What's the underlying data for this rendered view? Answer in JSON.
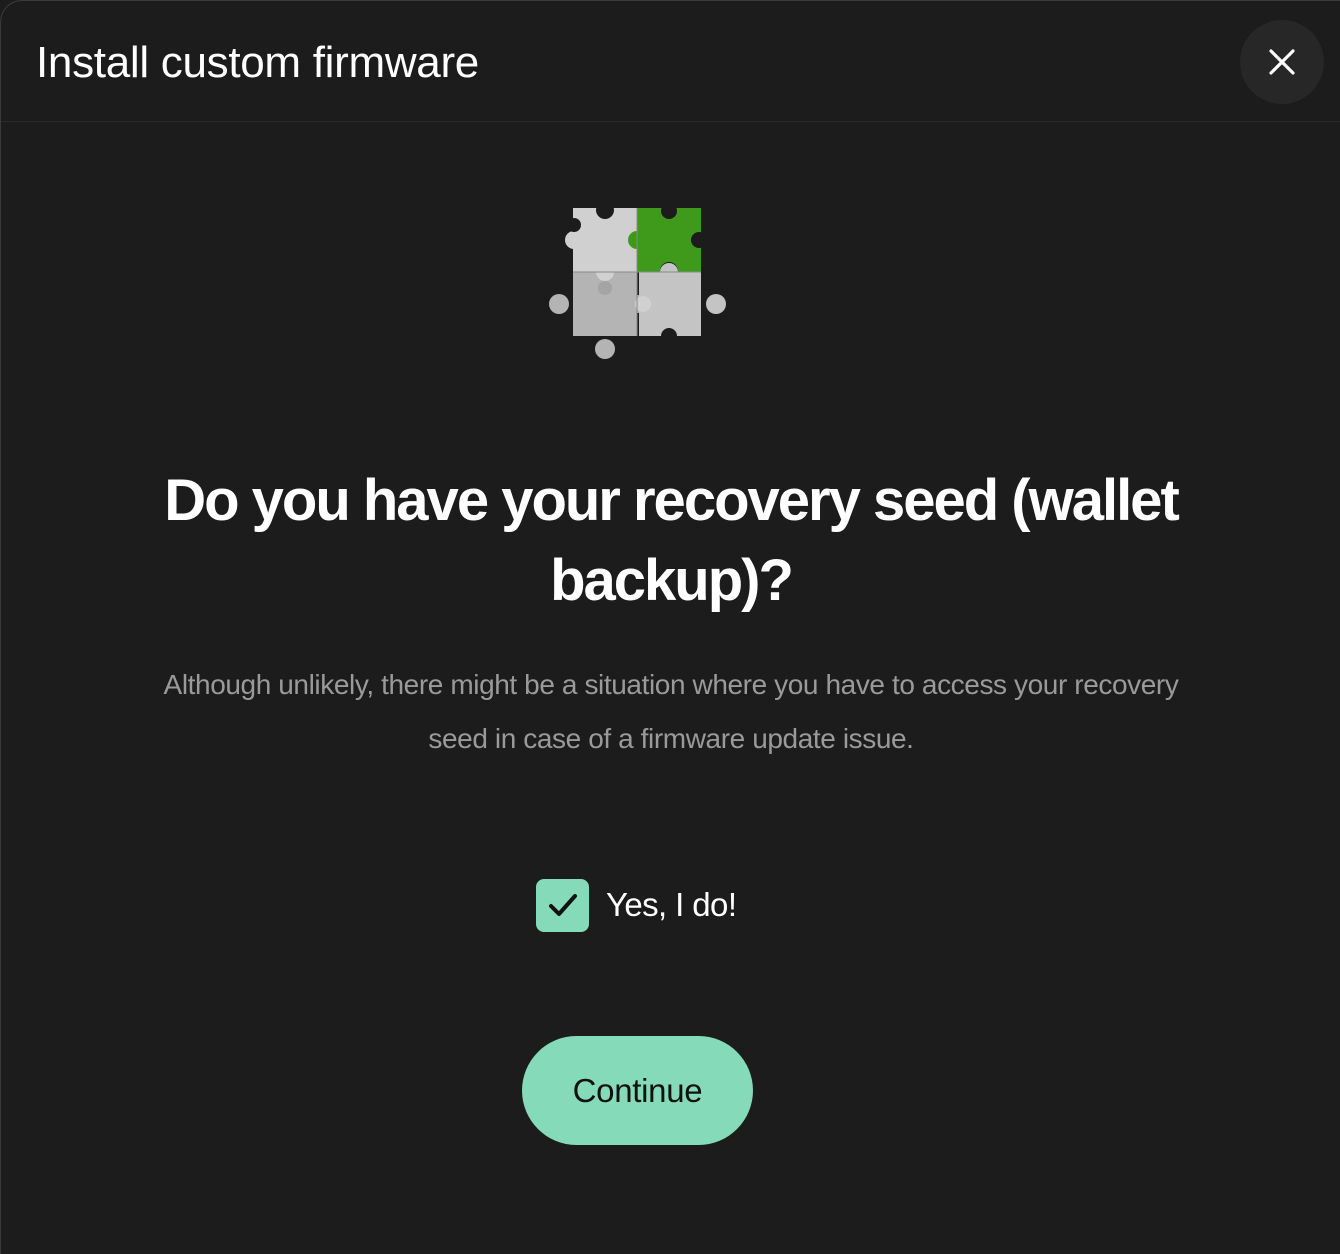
{
  "modal": {
    "title": "Install custom firmware",
    "close_icon": "close-icon"
  },
  "illustration": {
    "icon": "puzzle-icon",
    "colors": {
      "light": "#d3d3d3",
      "mid": "#b4b4b4",
      "accent": "#3f9a1c"
    }
  },
  "content": {
    "heading": "Do you have your recovery seed (wallet backup)?",
    "description": "Although unlikely, there might be a situation where you have to access your recovery seed in case of a firmware update issue."
  },
  "confirm": {
    "checked": true,
    "label": "Yes, I do!",
    "icon": "checkmark-icon"
  },
  "actions": {
    "continue_label": "Continue"
  },
  "colors": {
    "background": "#1c1c1c",
    "accent": "#84dab9",
    "text": "#ffffff",
    "muted_text": "#9a9a9a"
  }
}
